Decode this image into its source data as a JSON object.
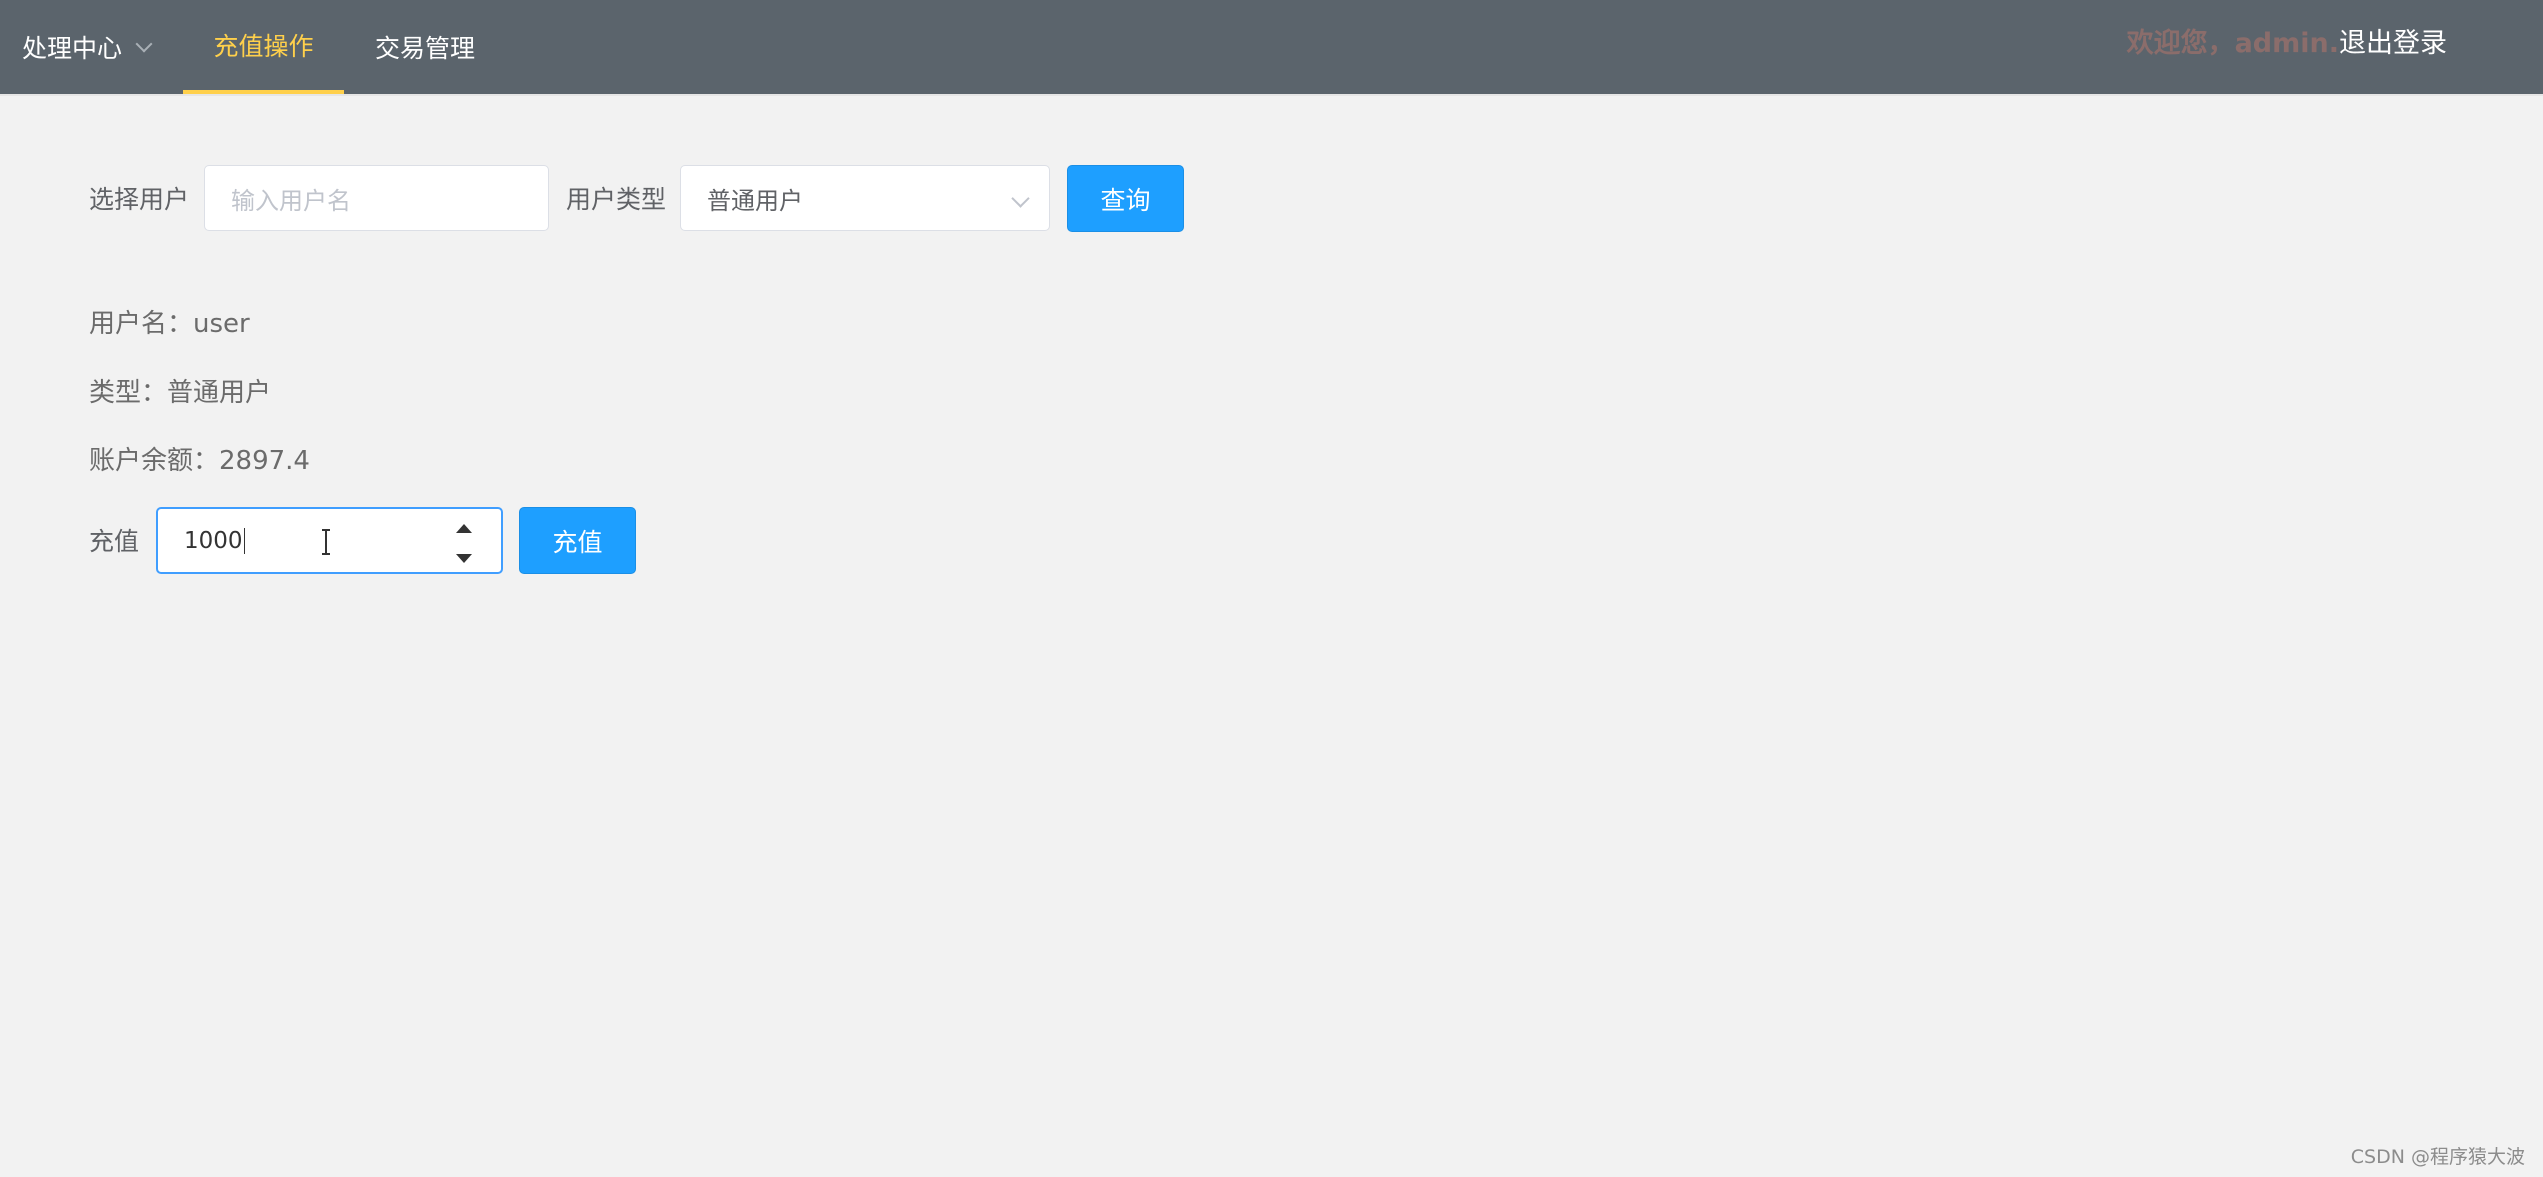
{
  "topbar": {
    "menu": {
      "submenu_label": "处理中心",
      "tabs": [
        {
          "label": "充值操作",
          "active": true
        },
        {
          "label": "交易管理",
          "active": false
        }
      ]
    },
    "welcome": "欢迎您，admin.",
    "logout": "退出登录"
  },
  "query_form": {
    "user_label": "选择用户",
    "user_placeholder": "输入用户名",
    "type_label": "用户类型",
    "type_selected": "普通用户",
    "query_button": "查询"
  },
  "user_info": {
    "username_line": "用户名：user",
    "type_line": "类型：普通用户",
    "balance_line": "账户余额：2897.4"
  },
  "recharge": {
    "label": "充值",
    "value": "1000",
    "button": "充值"
  },
  "watermark": "CSDN @程序猿大波",
  "colors": {
    "topbar_bg": "#5b646c",
    "active_tab": "#ffd04b",
    "primary_button": "#1e9fff",
    "page_bg": "#f2f2f2"
  }
}
